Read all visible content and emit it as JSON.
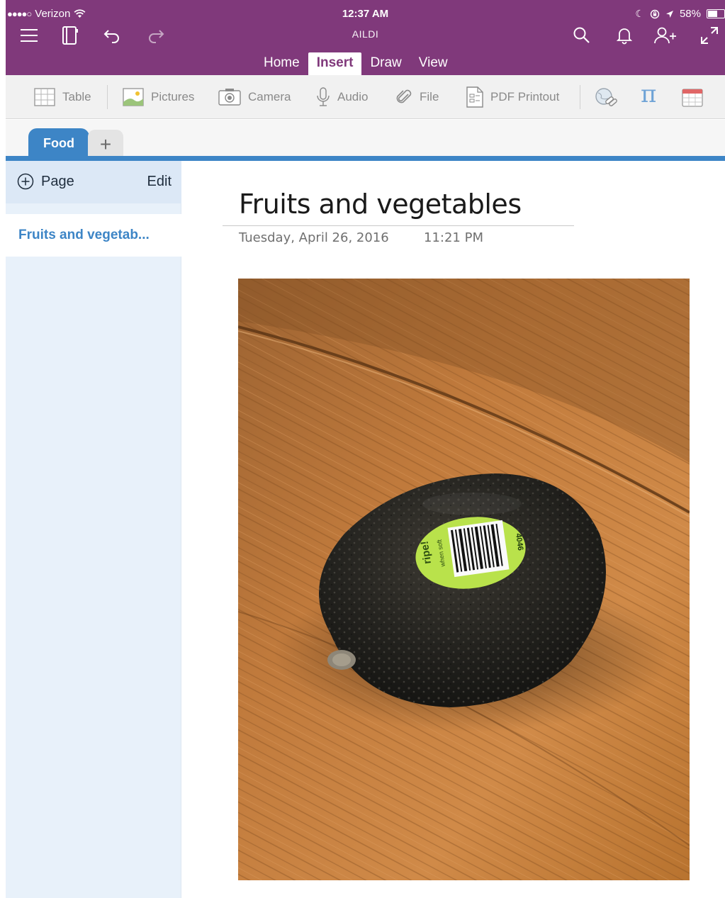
{
  "status_bar": {
    "signal": "●●●●○",
    "carrier": "Verizon",
    "time": "12:37 AM",
    "battery": "58%",
    "battery_level_percent": 58
  },
  "app": {
    "notebook_title": "AILDI"
  },
  "toolbar_icons": [
    "menu-icon",
    "notebooks-icon",
    "undo-icon",
    "redo-icon",
    "search-icon",
    "bell-icon",
    "add-person-icon",
    "expand-icon"
  ],
  "tabs": [
    {
      "label": "Home",
      "active": false
    },
    {
      "label": "Insert",
      "active": true
    },
    {
      "label": "Draw",
      "active": false
    },
    {
      "label": "View",
      "active": false
    }
  ],
  "ribbon": {
    "table": "Table",
    "pictures": "Pictures",
    "camera": "Camera",
    "audio": "Audio",
    "file": "File",
    "pdf_printout": "PDF Printout",
    "pi_symbol": "π"
  },
  "section": {
    "name": "Food",
    "add_symbol": "+"
  },
  "pages_pane": {
    "add_page_label": "Page",
    "edit_label": "Edit",
    "selected_page": "Fruits and vegetab..."
  },
  "page": {
    "title": "Fruits and vegetables",
    "date": "Tuesday, April 26, 2016",
    "time": "11:21 PM"
  },
  "photo_sticker": {
    "brand": "ripe!",
    "tagline": "when soft",
    "plu": "4046"
  },
  "colors": {
    "header": "#80397B",
    "accent_blue": "#3D85C6",
    "pane_bg": "#E8F1FA"
  }
}
